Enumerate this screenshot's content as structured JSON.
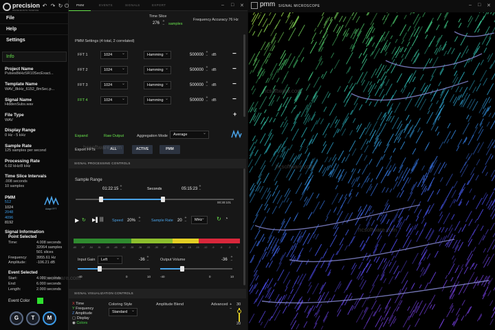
{
  "app": {
    "logo_name": "precision",
    "logo_sub": "WAVELENGTH SCIENCE",
    "toolbar_icons": [
      "undo-icon",
      "redo-icon",
      "refresh-icon",
      "power-icon"
    ]
  },
  "menu": {
    "file": "File",
    "help": "Help",
    "settings": "Settings"
  },
  "info": {
    "tab_label": "Info",
    "project_name_label": "Project Name",
    "project_name": "Pulses8kHzSR10SecExact...",
    "template_name_label": "Template Name",
    "template_name": "WAV_8kHz_6152_8mSec.p...",
    "signal_name_label": "Signal Name",
    "signal_name": "HiddenSubs.wav",
    "file_type_label": "File Type",
    "file_type": "WAV",
    "display_range_label": "Display Range",
    "display_range": "0 Hz - 5 kHz",
    "sample_rate_label": "Sample Rate",
    "sample_rate": "125 samples per second",
    "processing_rate_label": "Processing Rate",
    "processing_rate": "6.02 kHz/8 kHz",
    "time_slice_label": "Time Slice Intervals",
    "time_slice_1": ".008 seconds",
    "time_slice_2": "10 samples",
    "pmm_label": "PMM",
    "pmm_values": [
      "512",
      "1024",
      "2048",
      "4096",
      "8192"
    ],
    "pmm_logo": "Adapt FFT",
    "signal_info_label": "Signal Information",
    "point_selected_label": "Point Selected",
    "time_key": "Time:",
    "time_val": "4.008 seconds",
    "samples_val": "32064 samples",
    "slices_val": "501 slices",
    "frequency_key": "Frequency:",
    "frequency_val": "3955.61 Hz",
    "amplitude_key": "Amplitude:",
    "amplitude_val": "-106.21 dB",
    "event_selected_label": "Event Selected",
    "start_key": "Start:",
    "start_val": "4.000 seconds",
    "end_key": "End:",
    "end_val": "6.000 seconds",
    "length_key": "Length:",
    "length_val": "2.000 seconds",
    "event_color_label": "Event Color",
    "event_color": "#2fe02f"
  },
  "gtm": [
    "G",
    "T",
    "M"
  ],
  "mid": {
    "tabs": [
      "PMM",
      "EVENTS",
      "SIGNALS",
      "EXPORT"
    ],
    "time_slice_label": "Time Slice",
    "time_slice_value": "276",
    "time_slice_unit": "samples",
    "freq_accuracy": "Frequency Accuracy 76 Hz",
    "pmm_settings": "PMM Settings (4 total, 2 correlated)",
    "ffts": [
      {
        "label": "FFT 1",
        "size": "1024",
        "window": "Hamming",
        "value": "500000",
        "unit": "dB",
        "correlated": false
      },
      {
        "label": "FFT 2",
        "size": "1024",
        "window": "Hamming",
        "value": "500000",
        "unit": "dB",
        "correlated": false
      },
      {
        "label": "FFT 3",
        "size": "1024",
        "window": "Hamming",
        "value": "500000",
        "unit": "dB",
        "correlated": false
      },
      {
        "label": "FFT 4",
        "size": "1024",
        "window": "Hamming",
        "value": "500000",
        "unit": "dB",
        "correlated": true
      }
    ],
    "add": "+",
    "expand": "Expand",
    "raw_output": "Raw Output",
    "aggregation_label": "Aggregation Mode",
    "aggregation_value": "Average",
    "export_label": "Export FFTs",
    "export_buttons": [
      "ALL",
      "ACTIVE",
      "PMM"
    ],
    "signal_processing": "SIGNAL PROCESSING CONTROLS",
    "sample_range": "Sample Range",
    "range_start": "01:22:15",
    "range_unit": "Seconds",
    "range_end": "05:15:23",
    "range_total": "00:30:101",
    "speed_label": "Speed",
    "speed_value": "20%",
    "sample_rate_label": "Sample Rate",
    "sample_rate_value": "20",
    "sample_rate_unit": "MHz",
    "meter_ticks": [
      "-60",
      "-57",
      "-54",
      "-51",
      "-48",
      "-45",
      "-42",
      "-39",
      "-36",
      "-33",
      "-30",
      "-27",
      "-24",
      "-21",
      "-18",
      "-15",
      "-12",
      "-9",
      "-6",
      "-3",
      "0"
    ],
    "input_gain_label": "Input Gain",
    "input_gain_channel": "Left",
    "input_gain_value": "-36",
    "input_gain_level": 0.3,
    "output_volume_label": "Output Volume",
    "output_volume_value": "-36",
    "output_volume_level": 0.3,
    "gain_scale": [
      "-40",
      "0",
      "10"
    ],
    "volume_scale": [
      "-40",
      "0",
      "10"
    ],
    "signal_vis": "SIGNAL VISUALIZATION CONTROLS",
    "legend": [
      {
        "key": "X",
        "label": "Time",
        "color": "#e83b3b"
      },
      {
        "key": "Y",
        "label": "Frequency",
        "color": "#4ad94a"
      },
      {
        "key": "Z",
        "label": "Amplitude",
        "color": "#4a8ae8"
      },
      {
        "key": "",
        "label": "Display",
        "color": "#cccccc"
      },
      {
        "key": "",
        "label": "Colors",
        "color": "#4ad94a"
      }
    ],
    "coloring_style_label": "Coloring Style",
    "coloring_style_value": "Standard",
    "amplitude_blend_label": "Amplitude Blend",
    "advanced_label": "Advanced",
    "advanced_top": "30",
    "advanced_bottom": "20"
  },
  "scope": {
    "logo": "pmm",
    "title": "SIGNAL MICROSCOPE",
    "watermarks": [
      "hcsoftware.com",
      "hcsoftware.com",
      "hcsoftware.com",
      "hcsoftware.com",
      "hcsoftware.com"
    ]
  }
}
